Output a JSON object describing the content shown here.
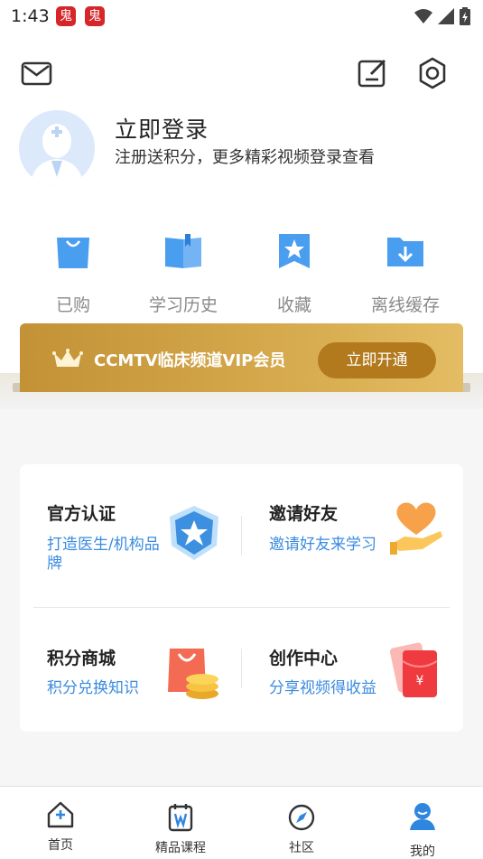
{
  "status_bar": {
    "time": "1:43",
    "app_badge": "鬼"
  },
  "header": {
    "mail_icon": "mail-icon",
    "edit_icon": "edit-icon",
    "settings_icon": "settings-icon"
  },
  "profile": {
    "login_title": "立即登录",
    "login_subtitle": "注册送积分，更多精彩视频登录查看"
  },
  "quick_actions": [
    {
      "label": "已购",
      "icon": "shopping-bag-icon"
    },
    {
      "label": "学习历史",
      "icon": "book-icon"
    },
    {
      "label": "收藏",
      "icon": "star-bookmark-icon"
    },
    {
      "label": "离线缓存",
      "icon": "download-folder-icon"
    }
  ],
  "vip": {
    "text": "CCMTV临床频道VIP会员",
    "button": "立即开通"
  },
  "services": [
    {
      "title": "官方认证",
      "subtitle": "打造医生/机构品牌",
      "icon": "certification-badge-icon"
    },
    {
      "title": "邀请好友",
      "subtitle": "邀请好友来学习",
      "icon": "invite-heart-icon"
    },
    {
      "title": "积分商城",
      "subtitle": "积分兑换知识",
      "icon": "points-shop-icon"
    },
    {
      "title": "创作中心",
      "subtitle": "分享视频得收益",
      "icon": "red-envelope-icon"
    }
  ],
  "tabbar": [
    {
      "label": "首页",
      "icon": "home-icon"
    },
    {
      "label": "精品课程",
      "icon": "course-icon"
    },
    {
      "label": "社区",
      "icon": "compass-icon"
    },
    {
      "label": "我的",
      "icon": "profile-icon",
      "active": true
    }
  ],
  "colors": {
    "accent_blue": "#3a8be0",
    "vip_gold": "#d4a84b",
    "vip_button": "#b27a1c"
  }
}
